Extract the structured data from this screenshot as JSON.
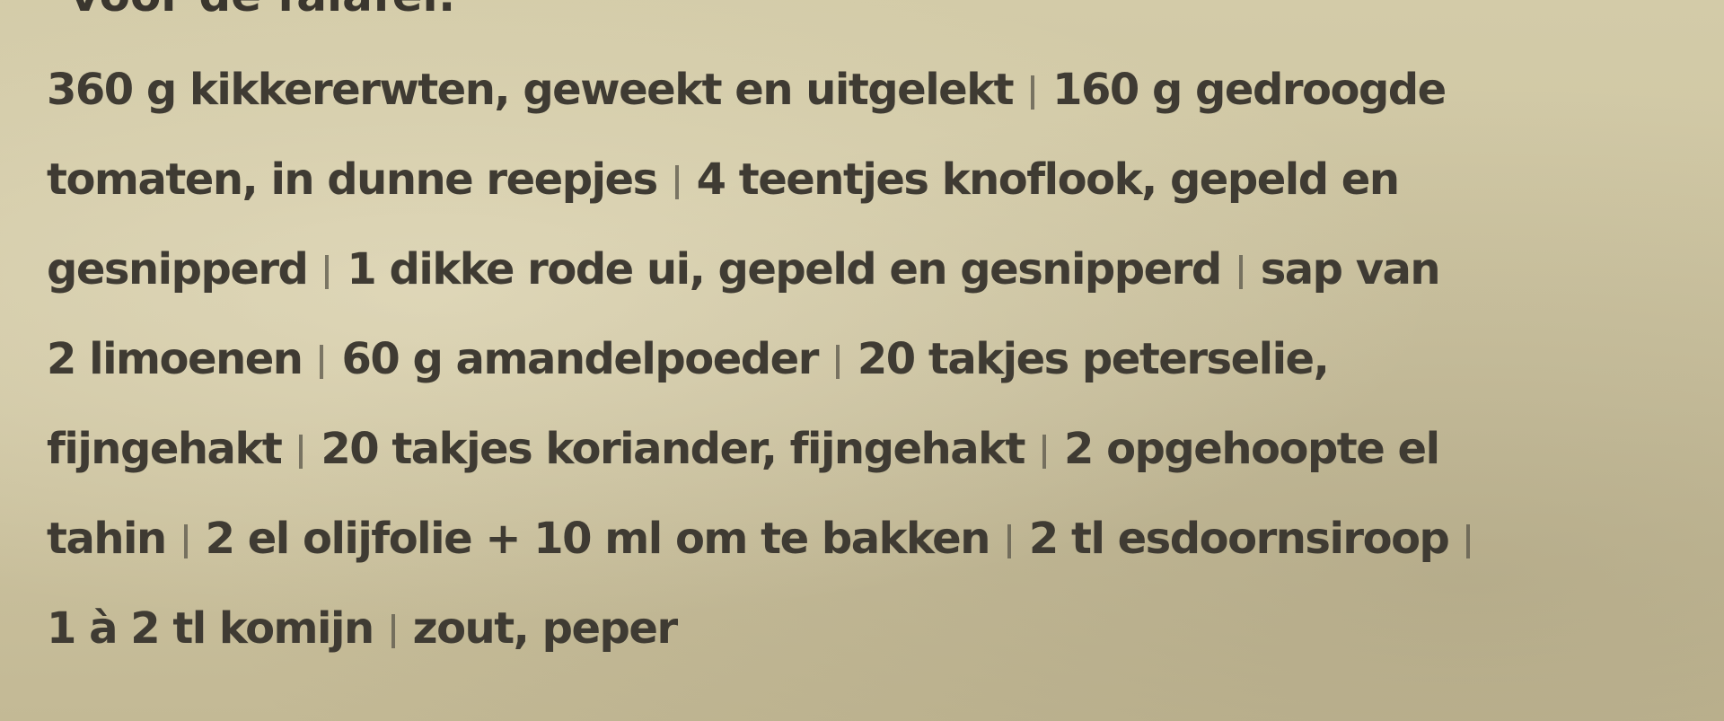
{
  "heading_partial": "voor de falafel:",
  "lines": [
    [
      "360 g kikkererwten, geweekt en uitgelekt",
      "160 g gedroogde"
    ],
    [
      "tomaten, in dunne reepjes",
      "4 teentjes knoflook, gepeld en"
    ],
    [
      "gesnipperd",
      "1 dikke rode ui, gepeld en gesnipperd",
      "sap van"
    ],
    [
      "2 limoenen",
      "60 g amandelpoeder",
      "20 takjes peterselie,"
    ],
    [
      "fijngehakt",
      "20 takjes koriander, fijngehakt",
      "2 opgehoopte el"
    ],
    [
      "tahin",
      "2 el olijfolie + 10 ml om te bakken",
      "2 tl esdoornsiroop",
      ""
    ],
    [
      "1 à 2 tl komijn",
      "zout, peper"
    ]
  ]
}
